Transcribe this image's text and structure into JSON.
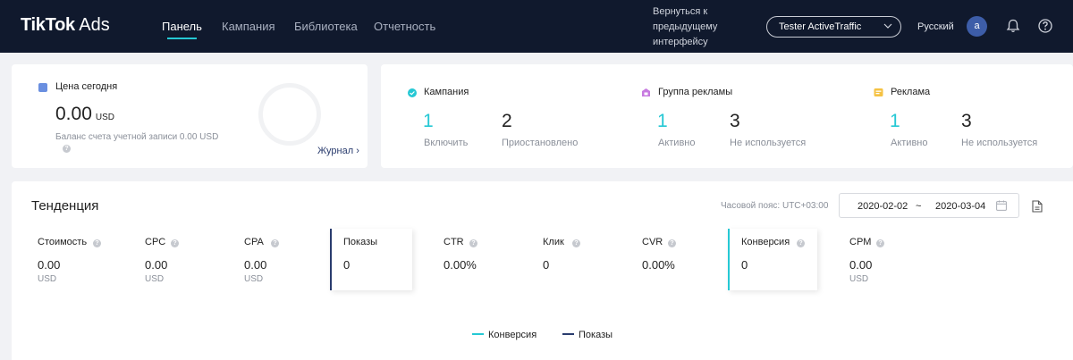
{
  "header": {
    "logo_main": "TikTok",
    "logo_suffix": " Ads",
    "nav": [
      "Панель",
      "Кампания",
      "Библиотека",
      "Отчетность"
    ],
    "back_link": "Вернуться к предыдущему интерфейсу",
    "account": "Tester ActiveTraffic",
    "language": "Русский",
    "avatar_letter": "a"
  },
  "balance": {
    "title": "Цена сегодня",
    "amount": "0.00",
    "currency": "USD",
    "note": "Баланс счета учетной записи 0.00 USD",
    "journal_link": "Журнал ›"
  },
  "stats": [
    {
      "title": "Кампания",
      "icon": "check-circle-icon",
      "first_value": "1",
      "first_label": "Включить",
      "second_value": "2",
      "second_label": "Приостановлено"
    },
    {
      "title": "Группа рекламы",
      "icon": "group-icon",
      "first_value": "1",
      "first_label": "Активно",
      "second_value": "3",
      "second_label": "Не используется"
    },
    {
      "title": "Реклама",
      "icon": "ad-icon",
      "first_value": "1",
      "first_label": "Активно",
      "second_value": "3",
      "second_label": "Не используется"
    }
  ],
  "trend": {
    "title": "Тенденция",
    "timezone": "Часовой пояс: UTC+03:00",
    "date_start": "2020-02-02",
    "date_sep": "~",
    "date_end": "2020-03-04",
    "metrics": [
      {
        "name": "Стоимость",
        "value": "0.00",
        "unit": "USD"
      },
      {
        "name": "CPC",
        "value": "0.00",
        "unit": "USD"
      },
      {
        "name": "CPA",
        "value": "0.00",
        "unit": "USD"
      },
      {
        "name": "Показы",
        "value": "0",
        "unit": ""
      },
      {
        "name": "CTR",
        "value": "0.00%",
        "unit": ""
      },
      {
        "name": "Клик",
        "value": "0",
        "unit": ""
      },
      {
        "name": "CVR",
        "value": "0.00%",
        "unit": ""
      },
      {
        "name": "Конверсия",
        "value": "0",
        "unit": ""
      },
      {
        "name": "CPM",
        "value": "0.00",
        "unit": "USD"
      }
    ],
    "legend": [
      "Конверсия",
      "Показы"
    ]
  },
  "colors": {
    "header_bg": "#10192d",
    "accent_cyan": "#25c8d4",
    "navy_series": "#2a3c6e"
  }
}
